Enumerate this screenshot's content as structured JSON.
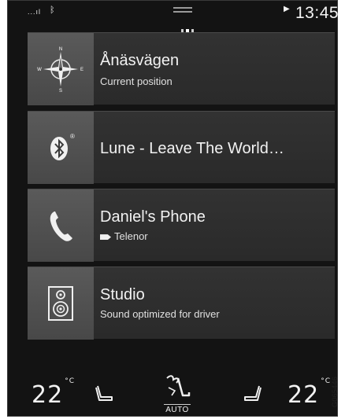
{
  "status": {
    "signal": "...ıl",
    "time": "13:45"
  },
  "tiles": [
    {
      "title": "Ånäsvägen",
      "subtitle": "Current position",
      "icon": "compass-icon"
    },
    {
      "title": "Lune - Leave The World…",
      "subtitle": "",
      "icon": "bluetooth-icon"
    },
    {
      "title": "Daniel's Phone",
      "subtitle": "Telenor",
      "icon": "phone-icon"
    },
    {
      "title": "Studio",
      "subtitle": "Sound optimized for driver",
      "icon": "speaker-icon"
    }
  ],
  "climate": {
    "left_temp": "22",
    "right_temp": "22",
    "unit": "°C",
    "mode": "AUTO"
  },
  "figure_code": "G065446"
}
